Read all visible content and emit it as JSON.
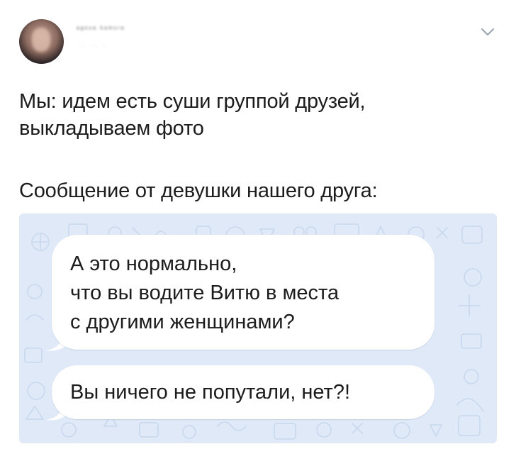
{
  "author": {
    "name": "ᵃᵍᵒᵘᵃ ᵏᵃᵐᵘʳᵃ",
    "handle": "·· ·· ·",
    "avatar_icon": "avatar-photo"
  },
  "menu_icon": "chevron-down-icon",
  "tweet": {
    "line1": "Мы: идем есть суши группой друзей,",
    "line2": "выкладываем фото",
    "line3": "Сообщение от девушки нашего друга:"
  },
  "chat": {
    "background_color": "#dfe9f7",
    "messages": [
      {
        "line1": "А это нормально,",
        "line2": "что вы водите Витю в места",
        "line3": "с другими женщинами?"
      },
      {
        "line1": "Вы ничего не попутали, нет?!"
      }
    ]
  }
}
